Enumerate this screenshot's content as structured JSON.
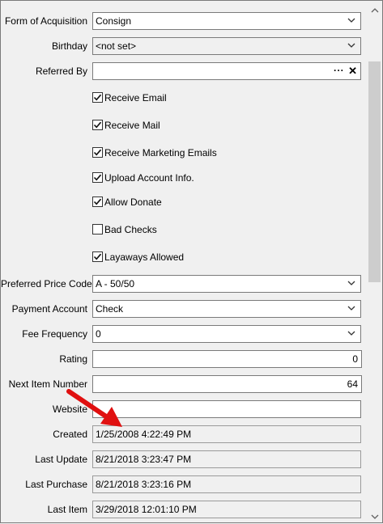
{
  "fields": {
    "form_of_acquisition": {
      "label": "Form of Acquisition",
      "value": "Consign"
    },
    "birthday": {
      "label": "Birthday",
      "value": "<not set>"
    },
    "referred_by": {
      "label": "Referred By",
      "value": "",
      "ellipsis": "...",
      "clear": "✕"
    },
    "preferred_price_code": {
      "label": "Preferred Price Code",
      "value": "A - 50/50"
    },
    "payment_account": {
      "label": "Payment Account",
      "value": "Check"
    },
    "fee_frequency": {
      "label": "Fee Frequency",
      "value": "0"
    },
    "rating": {
      "label": "Rating",
      "value": "0"
    },
    "next_item_number": {
      "label": "Next Item Number",
      "value": "64"
    },
    "website": {
      "label": "Website",
      "value": ""
    },
    "created": {
      "label": "Created",
      "value": "1/25/2008 4:22:49 PM"
    },
    "last_update": {
      "label": "Last Update",
      "value": "8/21/2018 3:23:47 PM"
    },
    "last_purchase": {
      "label": "Last Purchase",
      "value": "8/21/2018 3:23:16 PM"
    },
    "last_item": {
      "label": "Last Item",
      "value": "3/29/2018 12:01:10 PM"
    }
  },
  "checkboxes": [
    {
      "label": "Receive Email",
      "checked": true
    },
    {
      "label": "Receive Mail",
      "checked": true
    },
    {
      "label": "Receive Marketing Emails",
      "checked": true
    },
    {
      "label": "Upload Account Info.",
      "checked": true
    },
    {
      "label": "Allow Donate",
      "checked": true
    },
    {
      "label": "Bad Checks",
      "checked": false
    },
    {
      "label": "Layaways Allowed",
      "checked": true
    }
  ],
  "colors": {
    "annotation_arrow": "#e01010"
  }
}
